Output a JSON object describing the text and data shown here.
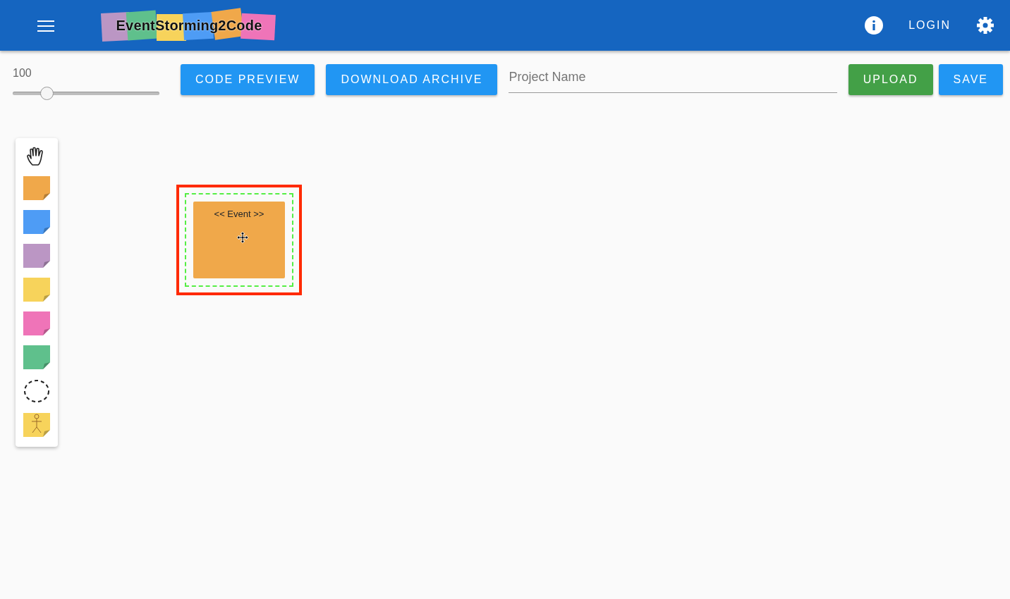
{
  "app_bar": {
    "logo_text": "EventStorming2Code",
    "login": "LOGIN"
  },
  "toolbar": {
    "zoom": {
      "reading": "100",
      "level": 0.23
    },
    "buttons": [
      {
        "label": "CODE PREVIEW",
        "kind": "primary"
      },
      {
        "label": "DOWNLOAD ARCHIVE",
        "kind": "primary"
      }
    ],
    "project_name": {
      "placeholder": "Project Name"
    },
    "actions": [
      {
        "label": "UPLOAD",
        "kind": "success"
      },
      {
        "label": "SAVE",
        "kind": "primary"
      }
    ]
  },
  "palette": [
    {
      "kind": "hand"
    },
    {
      "kind": "note",
      "color": "#f0a84a"
    },
    {
      "kind": "note",
      "color": "#4e9cf5"
    },
    {
      "kind": "note",
      "color": "#bb96c4"
    },
    {
      "kind": "note",
      "color": "#f7d35b"
    },
    {
      "kind": "note",
      "color": "#ef74b8"
    },
    {
      "kind": "note",
      "color": "#5fc08c"
    },
    {
      "kind": "boundary"
    },
    {
      "kind": "actor",
      "color": "#f7d35b"
    }
  ],
  "canvas": {
    "notes": [
      {
        "label": "<< Event >>",
        "color": "#f0a84a",
        "selected": true
      }
    ]
  }
}
